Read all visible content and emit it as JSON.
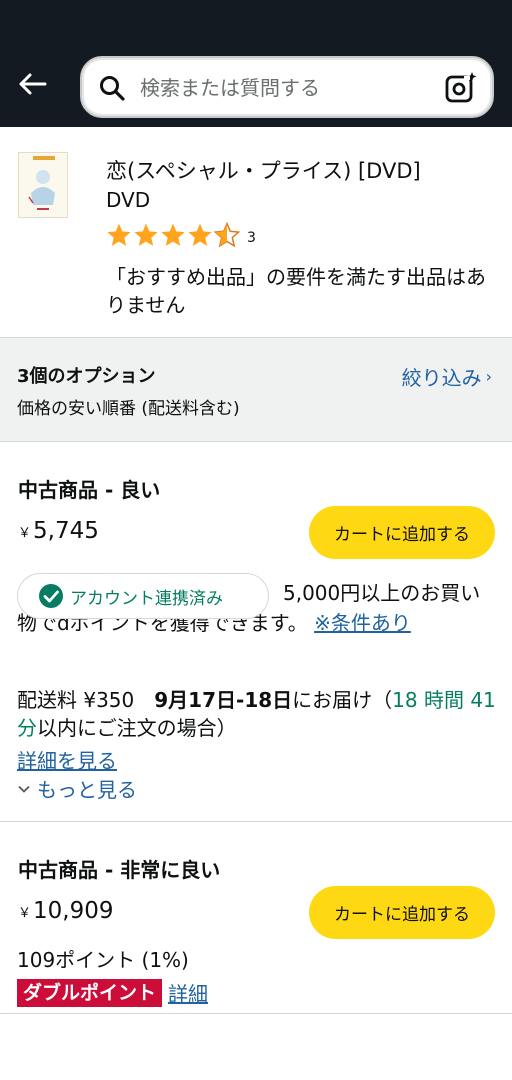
{
  "header": {
    "search_placeholder": "検索または質問する"
  },
  "product": {
    "title": "恋(スペシャル・プライス) [DVD]",
    "format": "DVD",
    "rating": 4.5,
    "rating_count": "3",
    "featured_note": "「おすすめ出品」の要件を満たす出品はありません"
  },
  "options": {
    "count_label": "3個のオプション",
    "sort_label": "価格の安い順番 (配送料含む)",
    "filter_label": "絞り込み"
  },
  "offers": [
    {
      "condition": "中古商品 - 良い",
      "currency": "￥",
      "price": "5,745",
      "cart_label": "カートに追加する",
      "linked_label": "アカウント連携済み",
      "points_promo": "5,000円以上のお買い物でdポイントを獲得できます。",
      "conditions_link": "※条件あり",
      "shipping_fee": "配送料 ¥350",
      "delivery_date": "9月17日-18日",
      "delivery_mid": "にお届け（",
      "countdown": "18 時間 41 分",
      "delivery_end": "以内にご注文の場合）",
      "details_link": "詳細を見る",
      "see_more": "もっと見る"
    },
    {
      "condition": "中古商品 - 非常に良い",
      "currency": "￥",
      "price": "10,909",
      "cart_label": "カートに追加する",
      "points": "109ポイント (1%)",
      "double_badge": "ダブルポイント",
      "double_link": "詳細"
    }
  ],
  "colors": {
    "header_bg": "#131a22",
    "cart_button": "#ffd814",
    "link": "#2162a1",
    "star": "#ffa41c",
    "green": "#067d62",
    "badge_red": "#cc0c39"
  }
}
